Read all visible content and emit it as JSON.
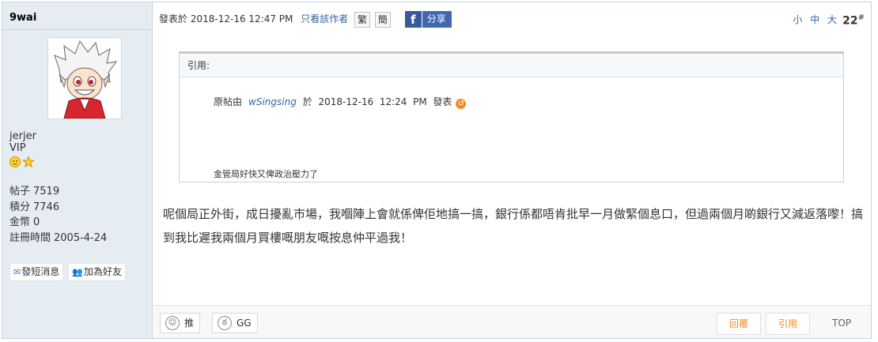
{
  "user": {
    "name": "9wai",
    "id": "jerjer",
    "group": "VIP",
    "stats": [
      {
        "label": "帖子",
        "value": "7519"
      },
      {
        "label": "積分",
        "value": "7746"
      },
      {
        "label": "金幣",
        "value": "0"
      },
      {
        "label": "註冊時間",
        "value": "2005-4-24"
      }
    ],
    "send_message": "發短消息",
    "add_friend": "加為好友"
  },
  "post": {
    "posted_prefix": "發表於",
    "posted_time": "2018-12-16 12:47 PM",
    "author_only": "只看該作者",
    "traditional": "繁",
    "simplified": "簡",
    "share_icon": "f",
    "share": "分享",
    "font_sizes": "小 中 大",
    "floor": "22",
    "floor_mark": "#"
  },
  "quote": {
    "header": "引用:",
    "by_prefix": "原帖由",
    "by_name": "wSingsing",
    "at": "於",
    "date": "2018-12-16",
    "time": "12:24",
    "ampm": "PM",
    "posted": "發表",
    "body": "金管局好快又俾政治壓力了"
  },
  "content": "呢個局正外街，成日擾亂市場，我嗰陣上會就係俾佢地搞一搞，銀行係都唔肯批早一月做緊個息口，但過兩個月啲銀行又減返落嚟！搞到我比遲我兩個月買樓嘅朋友嘅按息仲平過我！",
  "footer": {
    "push": "推",
    "gg": "GG",
    "reply": "回覆",
    "quote": "引用",
    "top": "TOP"
  },
  "colors": {
    "accent": "#f08a24",
    "link": "#336699",
    "sidebar": "#e5edf2",
    "facebook": "#3b5998"
  }
}
